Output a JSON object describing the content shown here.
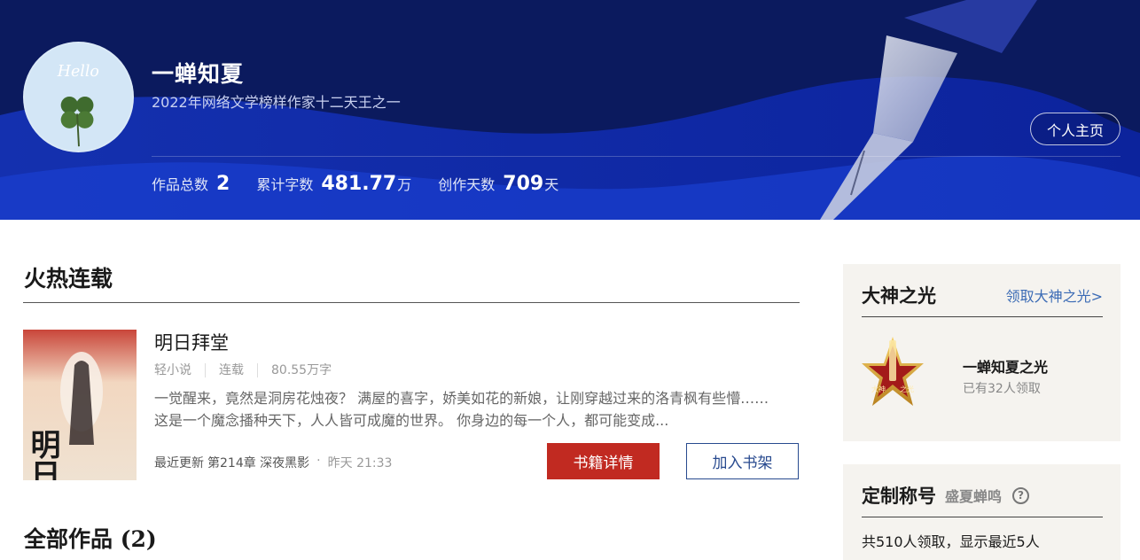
{
  "author": {
    "name": "一蝉知夏",
    "title": "2022年网络文学榜样作家十二天王之一",
    "avatar_text": "Hello",
    "homepage_label": "个人主页"
  },
  "stats": [
    {
      "label": "作品总数",
      "value": "2",
      "unit": ""
    },
    {
      "label": "累计字数",
      "value": "481.77",
      "unit": "万"
    },
    {
      "label": "创作天数",
      "value": "709",
      "unit": "天"
    }
  ],
  "hot": {
    "section_title": "火热连载",
    "book": {
      "name": "明日拜堂",
      "cover_text": "明日拜堂",
      "category": "轻小说",
      "status": "连载",
      "words": "80.55万字",
      "intro": "一觉醒来，竟然是洞房花烛夜？ 满屋的喜字，娇美如花的新娘，让刚穿越过来的洛青枫有些懵…… 这是一个魔念播种天下，人人皆可成魔的世界。 你身边的每一个人，都可能变成...",
      "update_label": "最近更新",
      "latest_chapter": "第214章 深夜黑影",
      "update_time": "昨天 21:33",
      "detail_label": "书籍详情",
      "shelf_label": "加入书架"
    }
  },
  "all_works": {
    "title": "全部作品 (2)"
  },
  "god_light": {
    "title": "大神之光",
    "link": "领取大神之光>",
    "badge_text_left": "大神",
    "badge_text_right": "之光",
    "name": "一蝉知夏之光",
    "count": "已有32人领取"
  },
  "custom_title": {
    "title": "定制称号",
    "subtitle": "盛夏蝉鸣",
    "help_icon": "?",
    "count": "共510人领取，显示最近5人"
  },
  "colors": {
    "banner": "#0b1a5e",
    "accent_red": "#c12a21",
    "link_blue": "#3b6bb5",
    "sidebar_bg": "#f5f3ef"
  }
}
